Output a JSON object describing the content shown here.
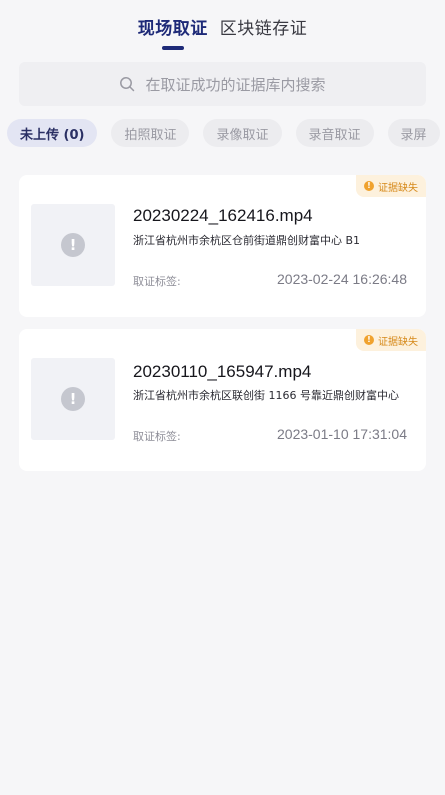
{
  "tabs": [
    {
      "label": "现场取证",
      "active": true
    },
    {
      "label": "区块链存证",
      "active": false
    }
  ],
  "search": {
    "placeholder": "在取证成功的证据库内搜索",
    "icon": "search-icon"
  },
  "filters": [
    {
      "label": "未上传 (0)",
      "active": true
    },
    {
      "label": "拍照取证",
      "active": false
    },
    {
      "label": "录像取证",
      "active": false
    },
    {
      "label": "录音取证",
      "active": false
    },
    {
      "label": "录屏",
      "active": false
    }
  ],
  "records": [
    {
      "badge": "证据缺失",
      "filename": "20230224_162416.mp4",
      "address": "浙江省杭州市余杭区仓前街道鼎创财富中心 B1",
      "tag_label": "取证标签:",
      "time": "2023-02-24 16:26:48"
    },
    {
      "badge": "证据缺失",
      "filename": "20230110_165947.mp4",
      "address": "浙江省杭州市余杭区联创街 1166 号靠近鼎创财富中心",
      "tag_label": "取证标签:",
      "time": "2023-01-10 17:31:04"
    }
  ],
  "colors": {
    "accent": "#1e2a78",
    "badge_text": "#d6891a",
    "badge_bg": "#fdf1dd",
    "background": "#f6f6f8"
  }
}
